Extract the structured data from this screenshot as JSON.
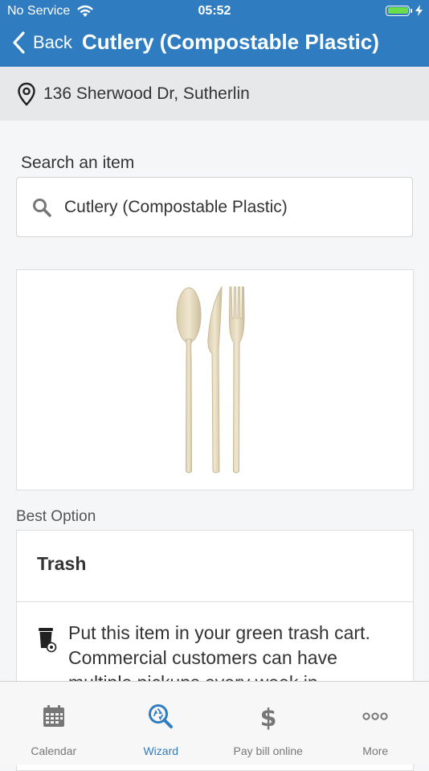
{
  "status_bar": {
    "carrier": "No Service",
    "time": "05:52"
  },
  "nav": {
    "back_label": "Back",
    "title": "Cutlery (Compostable Plastic)"
  },
  "address": {
    "text": "136 Sherwood Dr, Sutherlin"
  },
  "search": {
    "label": "Search an item",
    "value": "Cutlery (Compostable Plastic)"
  },
  "result": {
    "best_label": "Best Option",
    "option_title": "Trash",
    "instruction": "Put this item in your green trash cart. Commercial customers can have multiple pickups every week in"
  },
  "tabs": [
    {
      "label": "Calendar",
      "icon": "calendar-icon"
    },
    {
      "label": "Wizard",
      "icon": "wizard-search-icon"
    },
    {
      "label": "Pay bill online",
      "icon": "dollar-icon"
    },
    {
      "label": "More",
      "icon": "more-icon"
    }
  ],
  "colors": {
    "brand": "#2f7dc0",
    "battery": "#6ddc4b"
  }
}
